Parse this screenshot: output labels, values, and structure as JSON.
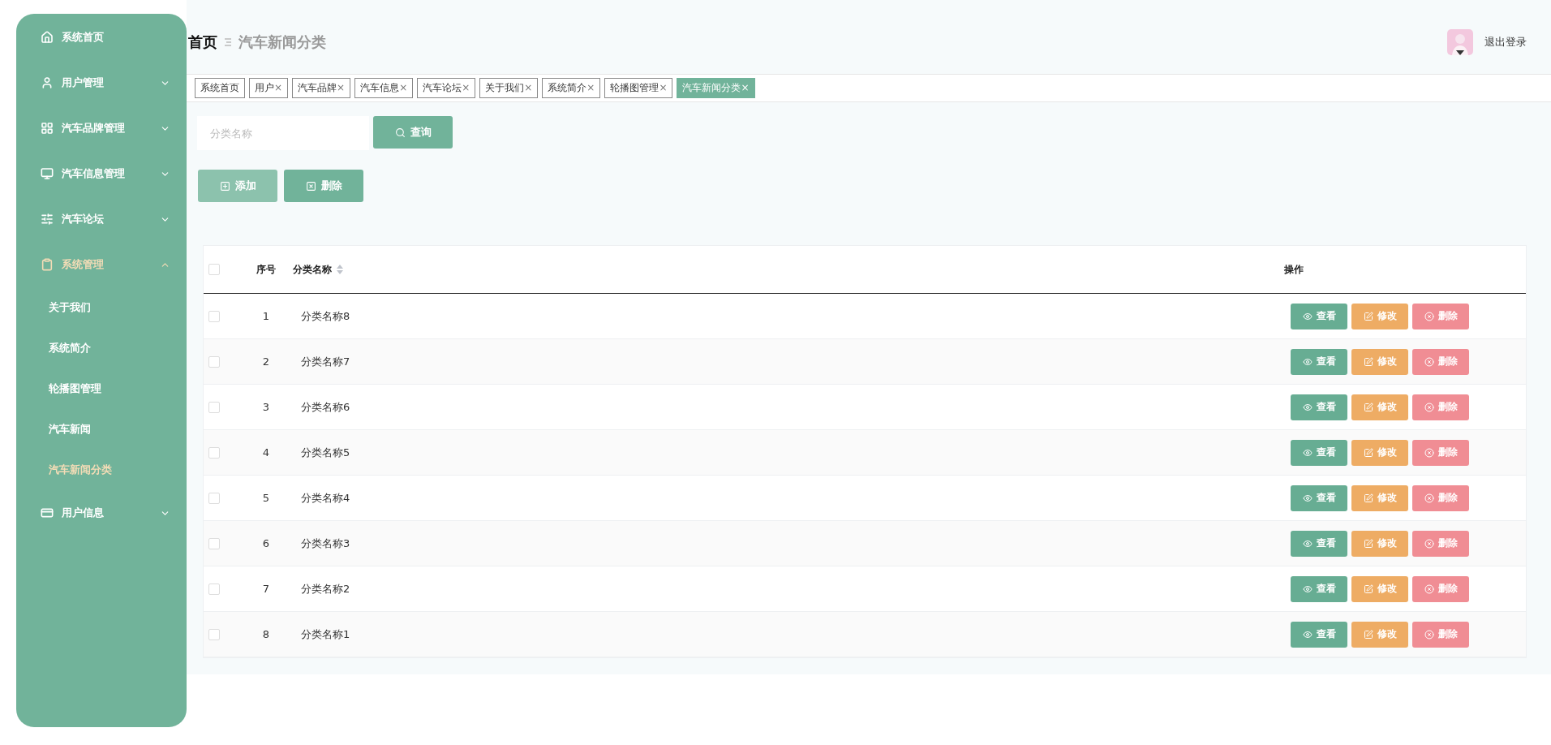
{
  "sidebar": {
    "items": [
      {
        "label": "系统首页",
        "selected": false
      },
      {
        "label": "用户管理",
        "selected": false,
        "expanded": false
      },
      {
        "label": "汽车品牌管理",
        "selected": false,
        "expanded": false
      },
      {
        "label": "汽车信息管理",
        "selected": false,
        "expanded": false
      },
      {
        "label": "汽车论坛",
        "selected": false,
        "expanded": false
      },
      {
        "label": "系统管理",
        "selected": true,
        "expanded": true,
        "children": [
          {
            "label": "关于我们",
            "selected": false
          },
          {
            "label": "系统简介",
            "selected": false
          },
          {
            "label": "轮播图管理",
            "selected": false
          },
          {
            "label": "汽车新闻",
            "selected": false
          },
          {
            "label": "汽车新闻分类",
            "selected": true
          }
        ]
      },
      {
        "label": "用户信息",
        "selected": false,
        "expanded": false
      }
    ]
  },
  "header": {
    "breadcrumb": [
      "首页",
      "汽车新闻分类"
    ],
    "logout": "退出登录"
  },
  "tabs": [
    {
      "label": "系统首页",
      "selected": false
    },
    {
      "label": "用户",
      "close": "×",
      "selected": false
    },
    {
      "label": "汽车品牌",
      "close": "×",
      "selected": false
    },
    {
      "label": "汽车信息",
      "close": "×",
      "selected": false
    },
    {
      "label": "汽车论坛",
      "close": "×",
      "selected": false
    },
    {
      "label": "关于我们",
      "close": "×",
      "selected": false
    },
    {
      "label": "系统简介",
      "close": "×",
      "selected": false
    },
    {
      "label": "轮播图管理",
      "close": "×",
      "selected": false
    },
    {
      "label": "汽车新闻分类",
      "close": "×",
      "selected": true
    }
  ],
  "search": {
    "placeholder": "分类名称",
    "button": "查询"
  },
  "toolbar": [
    {
      "label": "添加",
      "kind": "add",
      "hovered": true
    },
    {
      "label": "删除",
      "kind": "delete",
      "hovered": false
    }
  ],
  "table": {
    "header_checked": false,
    "columns": [
      {
        "label": "序号",
        "sortable": false
      },
      {
        "label": "分类名称",
        "sortable": true
      },
      {
        "label": "操作",
        "sortable": false
      }
    ],
    "rows": [
      {
        "index": "1",
        "name": "分类名称8",
        "checked": false,
        "actions": [
          {
            "label": "查看",
            "kind": "view"
          },
          {
            "label": "修改",
            "kind": "edit"
          },
          {
            "label": "删除",
            "kind": "delete"
          }
        ]
      },
      {
        "index": "2",
        "name": "分类名称7",
        "checked": false,
        "actions": [
          {
            "label": "查看",
            "kind": "view"
          },
          {
            "label": "修改",
            "kind": "edit"
          },
          {
            "label": "删除",
            "kind": "delete"
          }
        ]
      },
      {
        "index": "3",
        "name": "分类名称6",
        "checked": false,
        "actions": [
          {
            "label": "查看",
            "kind": "view"
          },
          {
            "label": "修改",
            "kind": "edit"
          },
          {
            "label": "删除",
            "kind": "delete"
          }
        ]
      },
      {
        "index": "4",
        "name": "分类名称5",
        "checked": false,
        "actions": [
          {
            "label": "查看",
            "kind": "view"
          },
          {
            "label": "修改",
            "kind": "edit"
          },
          {
            "label": "删除",
            "kind": "delete"
          }
        ]
      },
      {
        "index": "5",
        "name": "分类名称4",
        "checked": false,
        "actions": [
          {
            "label": "查看",
            "kind": "view"
          },
          {
            "label": "修改",
            "kind": "edit"
          },
          {
            "label": "删除",
            "kind": "delete"
          }
        ]
      },
      {
        "index": "6",
        "name": "分类名称3",
        "checked": false,
        "actions": [
          {
            "label": "查看",
            "kind": "view"
          },
          {
            "label": "修改",
            "kind": "edit"
          },
          {
            "label": "删除",
            "kind": "delete"
          }
        ]
      },
      {
        "index": "7",
        "name": "分类名称2",
        "checked": false,
        "actions": [
          {
            "label": "查看",
            "kind": "view"
          },
          {
            "label": "修改",
            "kind": "edit"
          },
          {
            "label": "删除",
            "kind": "delete"
          }
        ]
      },
      {
        "index": "8",
        "name": "分类名称1",
        "checked": false,
        "actions": [
          {
            "label": "查看",
            "kind": "view"
          },
          {
            "label": "修改",
            "kind": "edit"
          },
          {
            "label": "删除",
            "kind": "delete"
          }
        ]
      }
    ]
  }
}
